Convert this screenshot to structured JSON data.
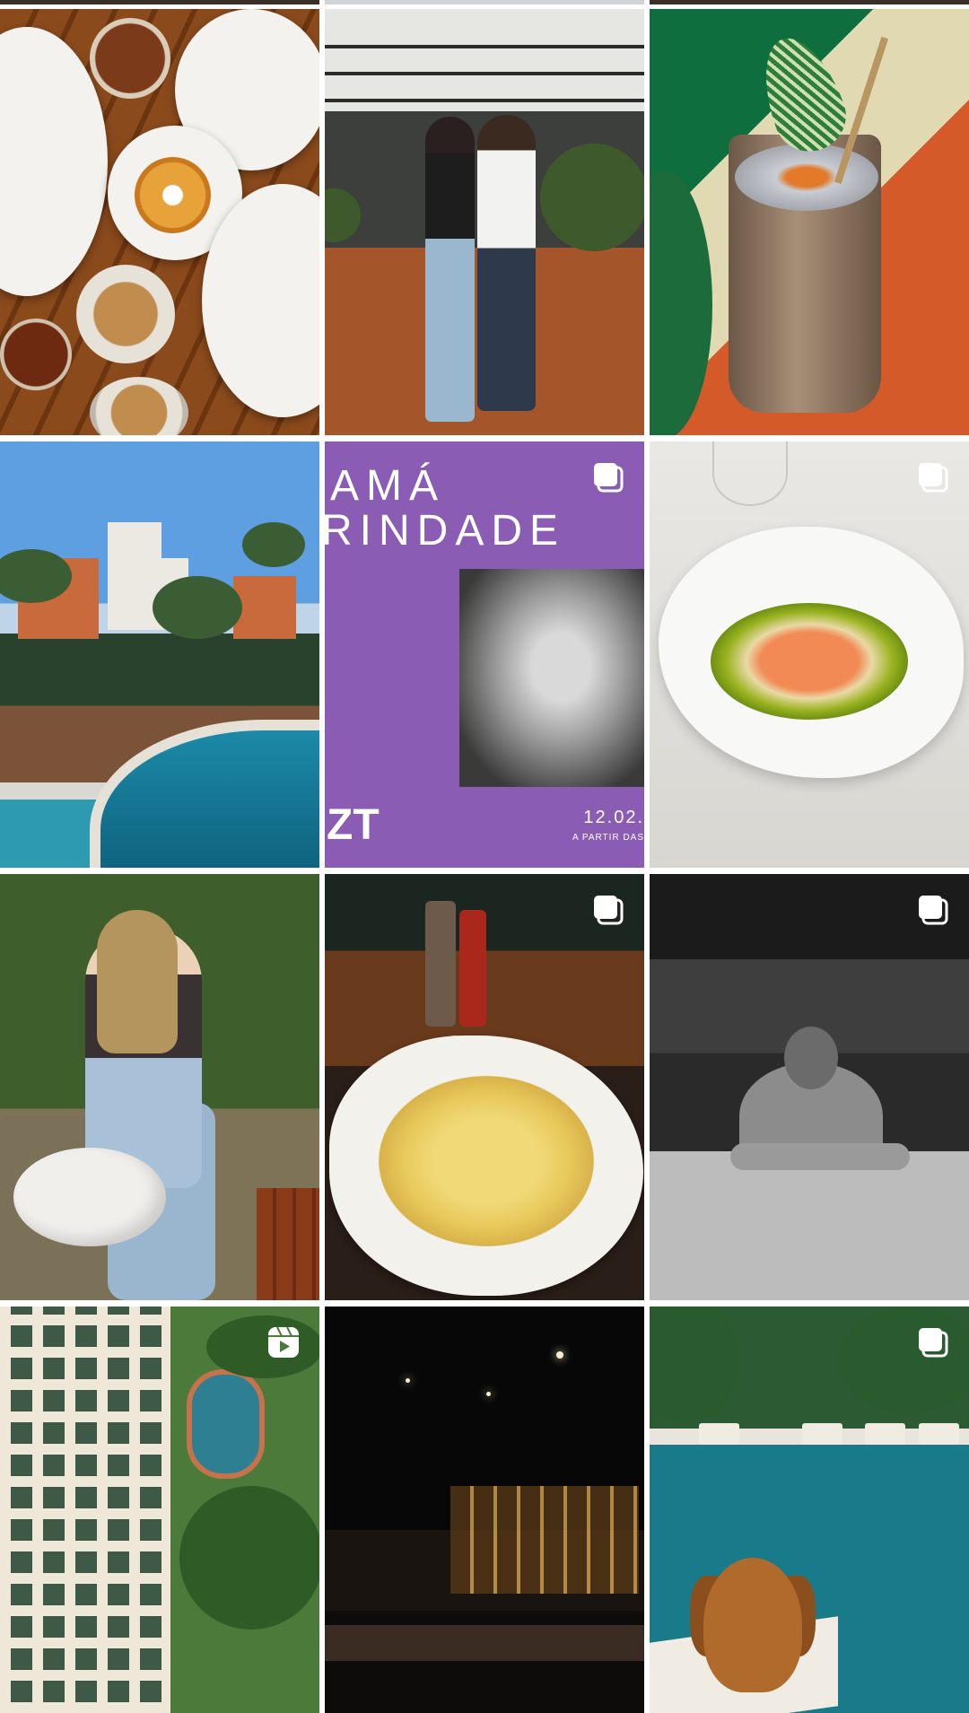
{
  "posts": [
    {
      "id": "brunch",
      "icon": null
    },
    {
      "id": "couple",
      "icon": null
    },
    {
      "id": "drink",
      "icon": null
    },
    {
      "id": "pool-palms",
      "icon": null
    },
    {
      "id": "poster",
      "icon": "carousel-icon",
      "poster_line1": "AMÁ",
      "poster_line2": "RINDADE",
      "poster_date": "12.02.",
      "poster_sub": "A PARTIR DAS",
      "poster_logo": "ZT"
    },
    {
      "id": "crudo",
      "icon": "carousel-icon"
    },
    {
      "id": "woman-cat",
      "icon": null
    },
    {
      "id": "pasta",
      "icon": "carousel-icon"
    },
    {
      "id": "bw-pool",
      "icon": "carousel-icon"
    },
    {
      "id": "building-aerial",
      "icon": "reel-icon"
    },
    {
      "id": "dark-bar",
      "icon": null
    },
    {
      "id": "dog-pool",
      "icon": "carousel-icon"
    }
  ],
  "colors": {
    "poster_purple": "#8a5cb3",
    "background": "#ffffff"
  }
}
